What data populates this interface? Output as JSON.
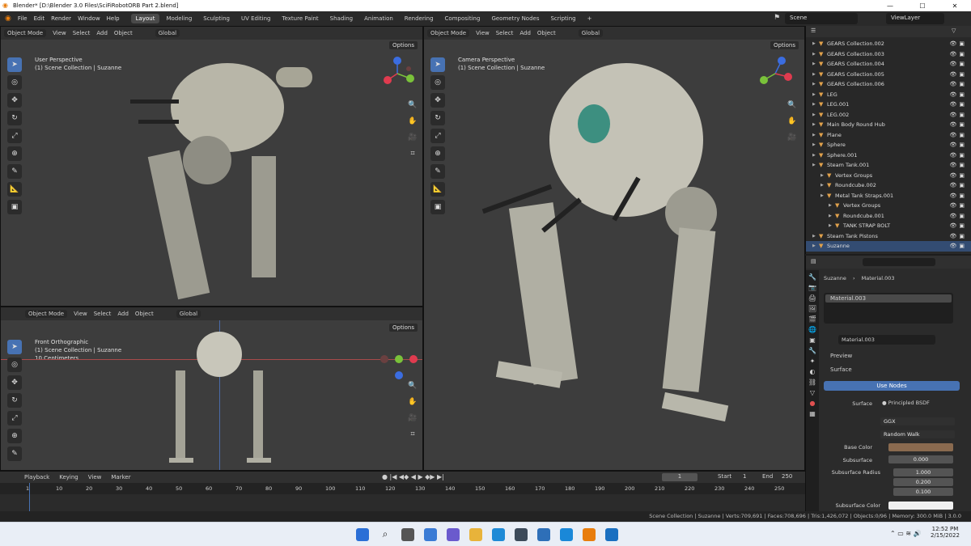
{
  "window": {
    "title": "Blender* [D:\\Blender 3.0 Files\\SciFiRobotORB Part 2.blend]"
  },
  "menu": [
    "File",
    "Edit",
    "Render",
    "Window",
    "Help"
  ],
  "workspaces": [
    "Layout",
    "Modeling",
    "Sculpting",
    "UV Editing",
    "Texture Paint",
    "Shading",
    "Animation",
    "Rendering",
    "Compositing",
    "Geometry Nodes",
    "Scripting"
  ],
  "scene": {
    "name": "Scene",
    "view_layer": "ViewLayer"
  },
  "viewport_top_left": {
    "mode": "Object Mode",
    "menus": [
      "View",
      "Select",
      "Add",
      "Object"
    ],
    "orientation": "Global",
    "options": "Options",
    "info": [
      "User Perspective",
      "(1) Scene Collection | Suzanne"
    ]
  },
  "viewport_bottom_left": {
    "mode": "Object Mode",
    "menus": [
      "View",
      "Select",
      "Add",
      "Object"
    ],
    "orientation": "Global",
    "options": "Options",
    "info": [
      "Front Orthographic",
      "(1) Scene Collection | Suzanne",
      "10 Centimeters"
    ]
  },
  "viewport_right": {
    "mode": "Object Mode",
    "menus": [
      "View",
      "Select",
      "Add",
      "Object"
    ],
    "orientation": "Global",
    "options": "Options",
    "info": [
      "Camera Perspective",
      "(1) Scene Collection | Suzanne"
    ]
  },
  "outliner": {
    "rows": [
      {
        "label": "GEARS Collection.002",
        "indent": 0
      },
      {
        "label": "GEARS Collection.003",
        "indent": 0
      },
      {
        "label": "GEARS Collection.004",
        "indent": 0
      },
      {
        "label": "GEARS Collection.005",
        "indent": 0
      },
      {
        "label": "GEARS Collection.006",
        "indent": 0
      },
      {
        "label": "LEG",
        "indent": 0
      },
      {
        "label": "LEG.001",
        "indent": 0
      },
      {
        "label": "LEG.002",
        "indent": 0
      },
      {
        "label": "Main Body Round Hub",
        "indent": 0
      },
      {
        "label": "Plane",
        "indent": 0
      },
      {
        "label": "Sphere",
        "indent": 0
      },
      {
        "label": "Sphere.001",
        "indent": 0
      },
      {
        "label": "Steam Tank.001",
        "indent": 0
      },
      {
        "label": "Vertex Groups",
        "indent": 1
      },
      {
        "label": "Roundcube.002",
        "indent": 1
      },
      {
        "label": "Metal Tank Straps.001",
        "indent": 1
      },
      {
        "label": "Vertex Groups",
        "indent": 2
      },
      {
        "label": "Roundcube.001",
        "indent": 2
      },
      {
        "label": "TANK STRAP BOLT",
        "indent": 2
      },
      {
        "label": "Steam Tank Pistons",
        "indent": 0
      },
      {
        "label": "Suzanne",
        "indent": 0
      }
    ]
  },
  "properties": {
    "breadcrumb_object": "Suzanne",
    "breadcrumb_material": "Material.003",
    "slot": "Material.003",
    "material_name": "Material.003",
    "preview": "Preview",
    "surface_panel": "Surface",
    "use_nodes": "Use Nodes",
    "surface_label": "Surface",
    "surface_value": "Principled BSDF",
    "distribution": "GGX",
    "subsurface_method": "Random Walk",
    "base_color_label": "Base Color",
    "base_color": "#8a6a4f",
    "subsurface_label": "Subsurface",
    "subsurface_value": "0.000",
    "subsurface_radius_label": "Subsurface Radius",
    "subsurface_radius": [
      "1.000",
      "0.200",
      "0.100"
    ],
    "subsurface_color_label": "Subsurface Color"
  },
  "timeline": {
    "menus": [
      "Playback",
      "Keying",
      "View",
      "Marker"
    ],
    "current_frame": "1",
    "start_label": "Start",
    "start": "1",
    "end_label": "End",
    "end": "250",
    "ticks": [
      "1",
      "10",
      "20",
      "30",
      "40",
      "50",
      "60",
      "70",
      "80",
      "90",
      "100",
      "110",
      "120",
      "130",
      "140",
      "150",
      "160",
      "170",
      "180",
      "190",
      "200",
      "210",
      "220",
      "230",
      "240",
      "250"
    ]
  },
  "status_bar": {
    "text": "Scene Collection | Suzanne | Verts:709,691 | Faces:708,696 | Tris:1,426,072 | Objects:0/96 | Memory: 300.0 MiB | 3.0.0"
  },
  "taskbar": {
    "time": "12:52 PM",
    "date": "2/15/2022"
  }
}
